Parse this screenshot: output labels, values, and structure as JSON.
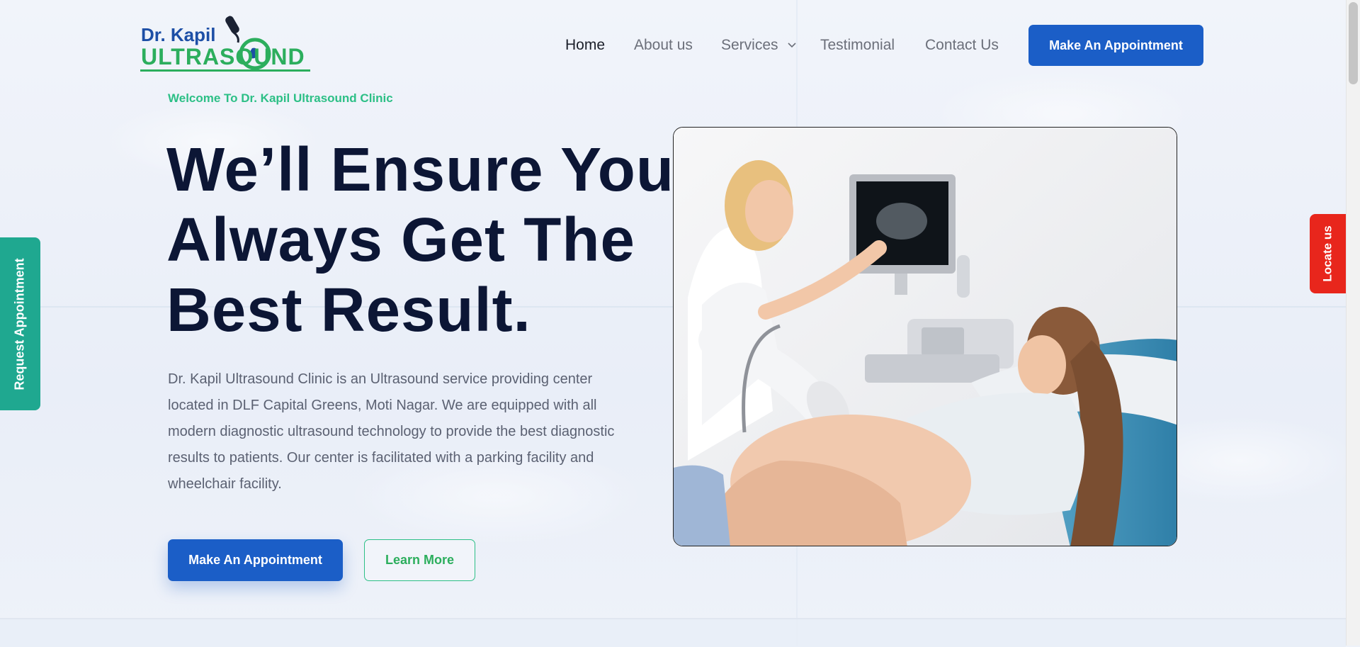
{
  "brand": {
    "line1": "Dr. Kapil",
    "line2": "ULTRASOUND"
  },
  "nav": {
    "items": [
      {
        "label": "Home",
        "active": true
      },
      {
        "label": "About us"
      },
      {
        "label": "Services",
        "has_dropdown": true
      },
      {
        "label": "Testimonial"
      },
      {
        "label": "Contact Us"
      }
    ],
    "cta_label": "Make An Appointment"
  },
  "hero": {
    "welcome": "Welcome To Dr. Kapil Ultrasound Clinic",
    "headline_lines": [
      "We’ll Ensure You",
      "Always Get The",
      "Best Result."
    ],
    "description": "Dr. Kapil Ultrasound Clinic is an Ultrasound service providing center located in DLF Capital Greens, Moti Nagar. We are equipped with all modern diagnostic ultrasound technology to provide the best diagnostic results to patients. Our center is facilitated with a parking facility and wheelchair facility.",
    "primary_cta": "Make An Appointment",
    "secondary_cta": "Learn More"
  },
  "side_tabs": {
    "request": "Request Appointment",
    "locate": "Locate us"
  },
  "colors": {
    "brand_blue": "#1b5ec7",
    "accent_green": "#2cbf86",
    "heading_navy": "#0c1635",
    "request_tab": "#1fa890",
    "locate_tab": "#e8261c"
  },
  "icons": {
    "dropdown": "chevron-down-icon",
    "logo_probe": "ultrasound-probe-icon",
    "logo_baby": "fetus-icon"
  }
}
